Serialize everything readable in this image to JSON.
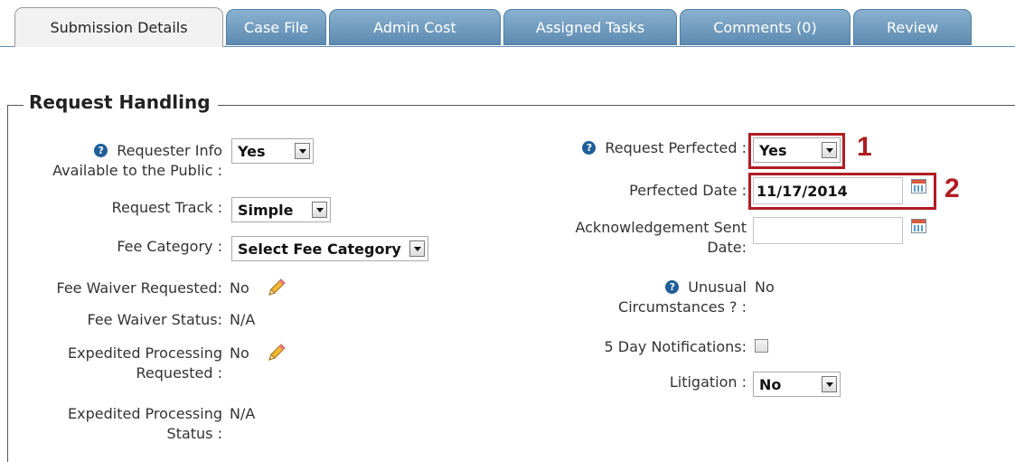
{
  "tabs": [
    {
      "label": "Submission Details",
      "active": true
    },
    {
      "label": "Case File"
    },
    {
      "label": "Admin Cost"
    },
    {
      "label": "Assigned Tasks"
    },
    {
      "label": "Comments (0)"
    },
    {
      "label": "Review"
    }
  ],
  "section": {
    "title": "Request Handling"
  },
  "left": {
    "requester_info": {
      "label_line1": "Requester Info",
      "label_line2": "Available to the Public :",
      "value": "Yes"
    },
    "request_track": {
      "label": "Request Track :",
      "value": "Simple"
    },
    "fee_category": {
      "label": "Fee Category :",
      "value": "Select Fee Category"
    },
    "fee_waiver_requested": {
      "label": "Fee Waiver Requested:",
      "value": "No"
    },
    "fee_waiver_status": {
      "label": "Fee Waiver Status:",
      "value": "N/A"
    },
    "expedited_requested": {
      "label_line1": "Expedited Processing",
      "label_line2": "Requested :",
      "value": "No"
    },
    "expedited_status": {
      "label_line1": "Expedited Processing",
      "label_line2": "Status :",
      "value": "N/A"
    }
  },
  "right": {
    "request_perfected": {
      "label": "Request Perfected :",
      "value": "Yes"
    },
    "perfected_date": {
      "label": "Perfected Date :",
      "value": "11/17/2014"
    },
    "ack_sent_date": {
      "label_line1": "Acknowledgement Sent",
      "label_line2": "Date:",
      "value": ""
    },
    "unusual_circumstances": {
      "label_line1": "Unusual",
      "label_line2": "Circumstances ? :",
      "value": "No"
    },
    "five_day_notifications": {
      "label": "5 Day Notifications:",
      "checked": false
    },
    "litigation": {
      "label": "Litigation :",
      "value": "No"
    }
  },
  "callouts": {
    "one": "1",
    "two": "2"
  },
  "icons": {
    "help": "?",
    "calendar": "calendar-icon",
    "pencil": "pencil-icon",
    "dropdown": "chevron-down-icon"
  },
  "colors": {
    "tab_blue": "#6e98bd",
    "accent_red": "#b01c22",
    "help_blue": "#1f5f99"
  }
}
